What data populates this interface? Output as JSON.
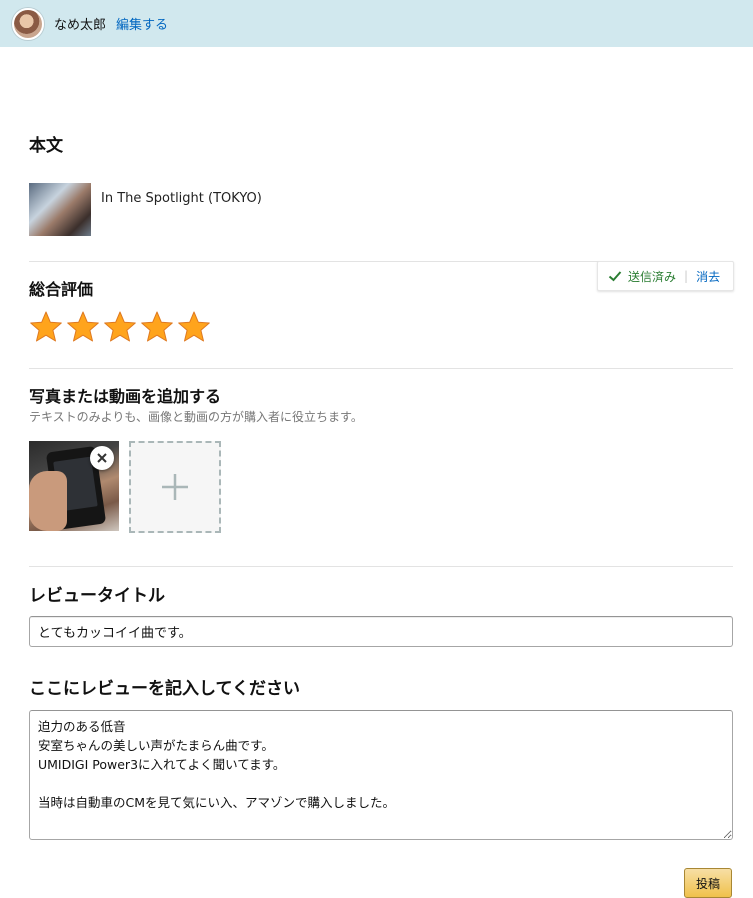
{
  "header": {
    "username": "なめ太郎",
    "edit_label": "編集する"
  },
  "body_section": {
    "title": "本文",
    "product_name": "In The Spotlight (TOKYO)"
  },
  "rating_section": {
    "title": "総合評価",
    "rating": 5,
    "max_rating": 5,
    "status_text": "送信済み",
    "clear_label": "消去",
    "star_color": "#ffa41c"
  },
  "media_section": {
    "title": "写真または動画を追加する",
    "subtitle": "テキストのみよりも、画像と動画の方が購入者に役立ちます。"
  },
  "review_title_section": {
    "title": "レビュータイトル",
    "value": "とてもカッコイイ曲です。"
  },
  "review_body_section": {
    "title": "ここにレビューを記入してください",
    "value": "迫力のある低音\n安室ちゃんの美しい声がたまらん曲です。\nUMIDIGI Power3に入れてよく聞いてます。\n\n当時は自動車のCMを見て気にい入、アマゾンで購入しました。"
  },
  "submit_label": "投稿",
  "colors": {
    "header_bg": "#d1e8ee",
    "link": "#0066c0",
    "success": "#2a7d32",
    "button": "#f0c14b"
  }
}
